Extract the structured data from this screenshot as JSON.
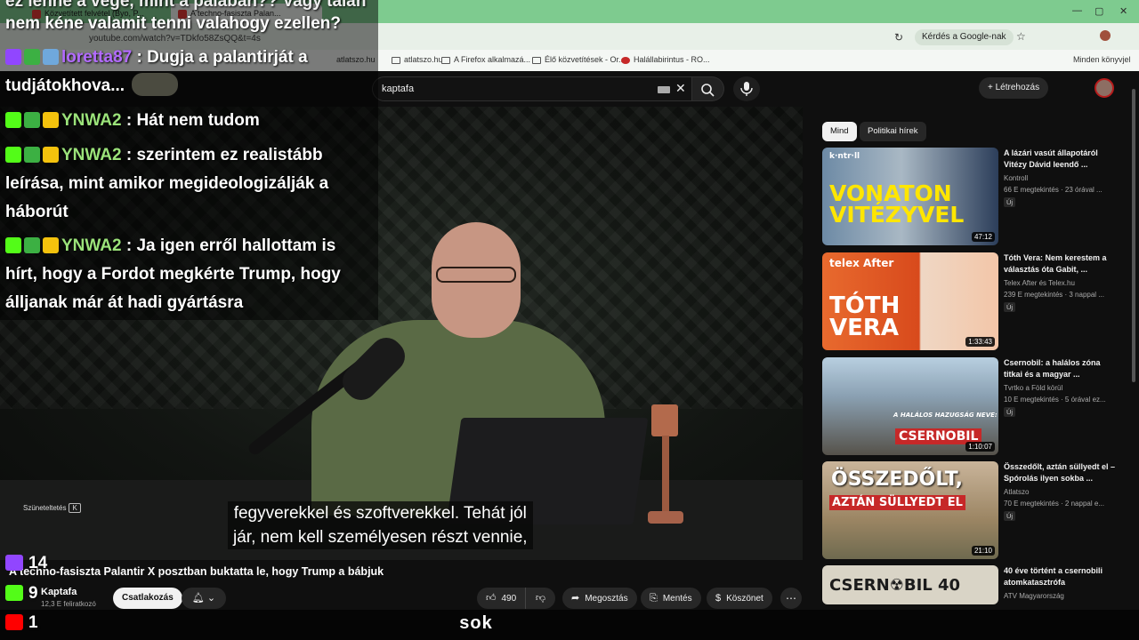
{
  "browser": {
    "tabs": [
      {
        "label": "Közvetített felvétel (Byo, P..."
      },
      {
        "label": "A techno-fasiszta Palan..."
      }
    ],
    "url": "youtube.com/watch?v=TDkfo58ZsQQ&t=4s",
    "ask_google": "Kérdés a Google-nak",
    "bookmarks": [
      "atlatszo.hu",
      "atlatszo.hu",
      "A Firefox alkalmazá...",
      "Élő közvetítések - Or...",
      "Halállabirintus - RO...",
      "Minden könyvjel"
    ]
  },
  "youtube": {
    "search_value": "kaptafa",
    "create_label": "Létrehozás"
  },
  "chat": {
    "top_fragment": "ez lenne a vége, mint a palaban?? Vagy talán",
    "top_fragment_2": "nem kéne valamit tenni valahogy ezellen?",
    "messages": [
      {
        "user": "loretta87",
        "line1": " : Dugja a palantirját a",
        "line2": "tudjátokhova..."
      },
      {
        "user": "YNWA2",
        "line1": " : Hát nem tudom"
      },
      {
        "user": "YNWA2",
        "line1": " : szerintem ez realistább",
        "line2": "leírása, mint amikor megideologizálják a",
        "line3": "háborút"
      },
      {
        "user": "YNWA2",
        "line1": " : Ja igen erről hallottam is",
        "line2": "hírt, hogy a Fordot megkérte Trump, hogy",
        "line3": "álljanak már át hadi gyártásra"
      }
    ]
  },
  "player": {
    "paused_label": "Szüneteltetés",
    "paused_key": "K",
    "caption_line1": "fegyverekkel és szoftverekkel. Tehát jól",
    "caption_line2": "jár, nem kell személyesen részt vennie,"
  },
  "video": {
    "title": "A techno-fasiszta Palantir X posztban buktatta le, hogy Trump a bábjuk",
    "channel": "Kaptafa",
    "subscribers": "12,3 E feliratkozó",
    "subscribe_label": "Csatlakozás",
    "likes": "490",
    "share_label": "Megosztás",
    "save_label": "Mentés",
    "thanks_label": "Köszönet"
  },
  "sidebar": {
    "chips": [
      {
        "label": "Mind"
      },
      {
        "label": "Politikai hírek"
      }
    ],
    "recommendations": [
      {
        "title": "A lázári vasút állapotáról Vitézy Dávid leendő ...",
        "channel": "Kontroll",
        "meta": "66 E megtekintés · 23 órával ...",
        "badge": "Új",
        "duration": "47:12",
        "thumb_text": "VONATON\nVITÉZYVEL",
        "thumb_tag": "k·ntr·ll"
      },
      {
        "title": "Tóth Vera: Nem kerestem a választás óta Gabit, ...",
        "channel": "Telex After és Telex.hu",
        "meta": "239 E megtekintés · 3 nappal ...",
        "badge": "Új",
        "duration": "1:33:43",
        "thumb_text": "TÓTH\nVERA",
        "thumb_tag": "telex After"
      },
      {
        "title": "Csernobil: a halálos zóna titkai és a magyar ...",
        "channel": "Tvrtko a Föld körül",
        "meta": "10 E megtekintés · 5 órával ez...",
        "badge": "Új",
        "duration": "1:10:07",
        "thumb_text": "CSERNOBIL",
        "thumb_tag": "A HALÁLOS HAZUGSÁG NEVE:"
      },
      {
        "title": "Összedőlt, aztán süllyedt el – Spórolás ilyen sokba ...",
        "channel": "Atlatszo",
        "meta": "70 E megtekintés · 2 nappal e...",
        "badge": "Új",
        "duration": "21:10",
        "thumb_text": "ÖSSZEDŐLT,",
        "thumb_tag": "AZTÁN SÜLLYEDT EL"
      },
      {
        "title": "40 éve történt a csernobili atomkatasztrófa",
        "channel": "ATV Magyarország",
        "meta": "",
        "badge": "",
        "duration": "",
        "thumb_text": "CSERN☢BIL 40",
        "thumb_tag": ""
      }
    ]
  },
  "stream": {
    "twitch_count": "14",
    "kick_count": "9",
    "youtube_count": "1",
    "bottom_word": "sok"
  },
  "colors": {
    "twitch": "#9146ff",
    "kick": "#53fc18",
    "youtube_red": "#ff0000",
    "loretta": "#b36bff",
    "ynwa": "#9be37a"
  }
}
